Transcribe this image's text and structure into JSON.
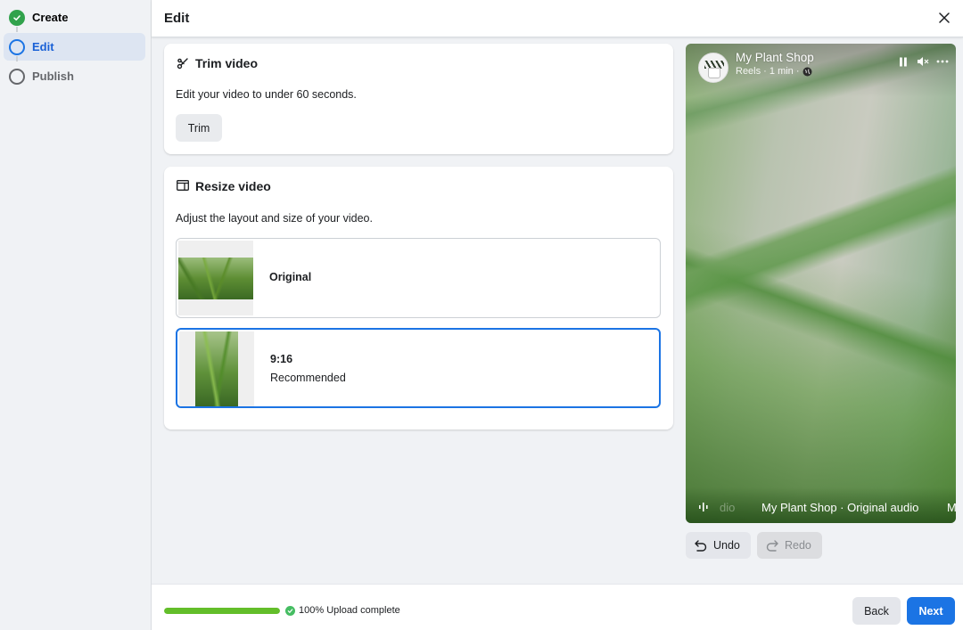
{
  "sidebar": {
    "steps": [
      {
        "label": "Create",
        "state": "complete"
      },
      {
        "label": "Edit",
        "state": "active"
      },
      {
        "label": "Publish",
        "state": "pending"
      }
    ]
  },
  "header": {
    "title": "Edit",
    "close_icon": "close-icon"
  },
  "trim": {
    "title": "Trim video",
    "icon": "scissors-icon",
    "description": "Edit your video to under 60 seconds.",
    "button_label": "Trim"
  },
  "resize": {
    "title": "Resize video",
    "icon": "resize-icon",
    "description": "Adjust the layout and size of your video.",
    "options": [
      {
        "label": "Original",
        "sublabel": "",
        "selected": false
      },
      {
        "label": "9:16",
        "sublabel": "Recommended",
        "selected": true
      }
    ]
  },
  "preview": {
    "page_name": "My Plant Shop",
    "subtitle": "Reels · 1 min ·",
    "audio_faded": "dio",
    "audio_text": "My Plant Shop · Original audio",
    "audio_overflow": "M"
  },
  "history": {
    "undo_label": "Undo",
    "redo_label": "Redo"
  },
  "footer": {
    "upload_progress_percent": 100,
    "upload_status": "100% Upload complete",
    "back_label": "Back",
    "next_label": "Next"
  },
  "colors": {
    "accent": "#1b74e4",
    "success": "#31a24c",
    "progress": "#63be2a"
  }
}
